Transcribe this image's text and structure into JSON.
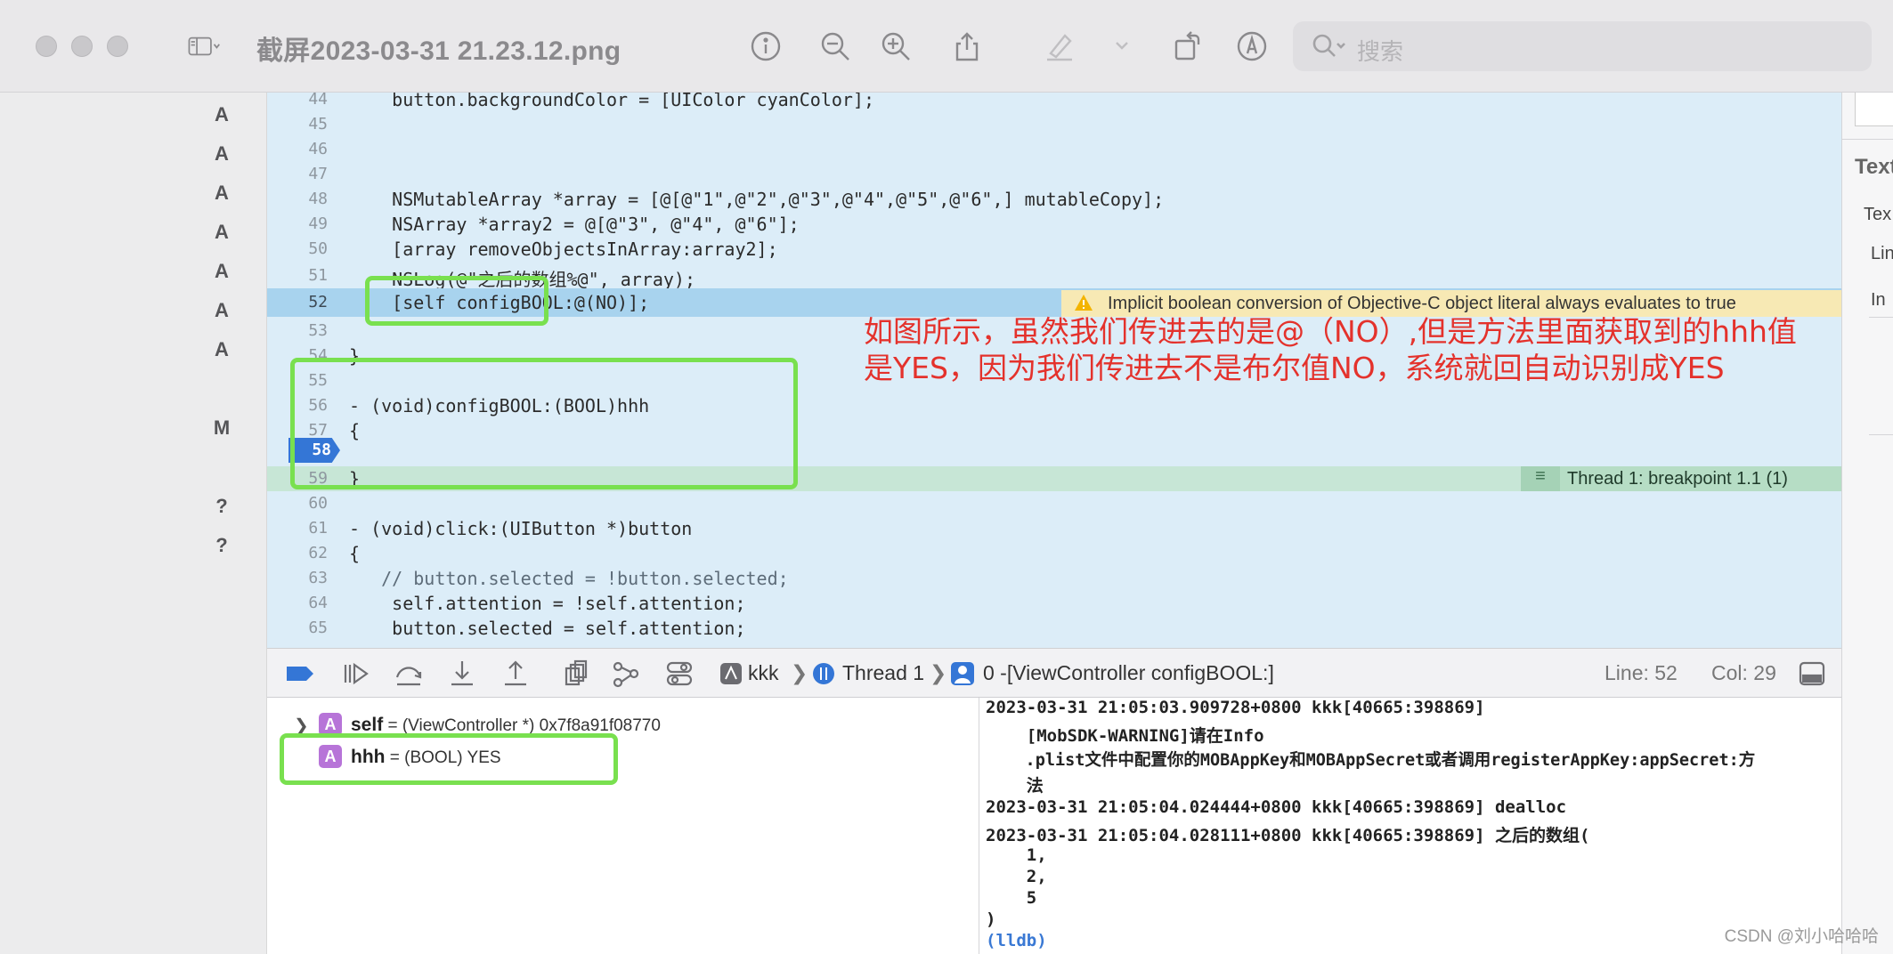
{
  "window": {
    "title": "截屏2023-03-31 21.23.12.png",
    "search_placeholder": "搜索"
  },
  "gutter": [
    "A",
    "A",
    "A",
    "A",
    "A",
    "A",
    "A",
    "M",
    "?",
    "?"
  ],
  "editor": {
    "lines": [
      {
        "n": "44",
        "code": "    button.backgroundColor = [UIColor cyanColor];"
      },
      {
        "n": "45",
        "code": "    "
      },
      {
        "n": "46",
        "code": ""
      },
      {
        "n": "47",
        "code": "    "
      },
      {
        "n": "48",
        "code": "    NSMutableArray *array = [@[@\"1\",@\"2\",@\"3\",@\"4\",@\"5\",@\"6\",] mutableCopy];"
      },
      {
        "n": "49",
        "code": "    NSArray *array2 = @[@\"3\", @\"4\", @\"6\"];"
      },
      {
        "n": "50",
        "code": "    [array removeObjectsInArray:array2];"
      },
      {
        "n": "51",
        "code": "    NSLog(@\"之后的数组%@\", array);"
      },
      {
        "n": "52",
        "code": "    [self configBOOL:@(NO)];"
      },
      {
        "n": "53",
        "code": "    "
      },
      {
        "n": "54",
        "code": "}"
      },
      {
        "n": "55",
        "code": ""
      },
      {
        "n": "56",
        "code": "- (void)configBOOL:(BOOL)hhh"
      },
      {
        "n": "57",
        "code": "{"
      },
      {
        "n": "58",
        "code": "    "
      },
      {
        "n": "59",
        "code": "}"
      },
      {
        "n": "60",
        "code": ""
      },
      {
        "n": "61",
        "code": "- (void)click:(UIButton *)button"
      },
      {
        "n": "62",
        "code": "{"
      },
      {
        "n": "63",
        "code": "   // button.selected = !button.selected;"
      },
      {
        "n": "64",
        "code": "    self.attention = !self.attention;"
      },
      {
        "n": "65",
        "code": "    button.selected = self.attention;"
      }
    ],
    "warning": "Implicit boolean conversion of Objective-C object literal always evaluates to true",
    "thread_label": "Thread 1: breakpoint 1.1 (1)",
    "breakpoint_line": "58",
    "annotation": "如图所示，虽然我们传进去的是@（NO）,但是方法里面获取到的hhh值是YES，因为我们传进去不是布尔值NO，系统就回自动识别成YES"
  },
  "debugbar": {
    "target": "kkk",
    "thread": "Thread 1",
    "frame": "0 -[ViewController configBOOL:]",
    "line": "Line: 52",
    "col": "Col: 29"
  },
  "variables": [
    {
      "name": "self",
      "value": " = (ViewController *) 0x7f8a91f08770",
      "badge": "A",
      "expandable": true
    },
    {
      "name": "hhh",
      "value": " = (BOOL) YES",
      "badge": "A",
      "expandable": false
    }
  ],
  "console": {
    "lines": [
      "2023-03-31 21:05:03.909728+0800 kkk[40665:398869]",
      "    [MobSDK-WARNING]请在Info",
      "    .plist文件中配置你的MOBAppKey和MOBAppSecret或者调用registerAppKey:appSecret:方",
      "    法",
      "2023-03-31 21:05:04.024444+0800 kkk[40665:398869] dealloc",
      "2023-03-31 21:05:04.028111+0800 kkk[40665:398869] 之后的数组(",
      "    1,",
      "    2,",
      "    5",
      ")"
    ],
    "prompt": "(lldb)"
  },
  "inspector": [
    "Text",
    "Tex",
    "Lin",
    "In"
  ],
  "watermark": "CSDN @刘小哈哈哈"
}
